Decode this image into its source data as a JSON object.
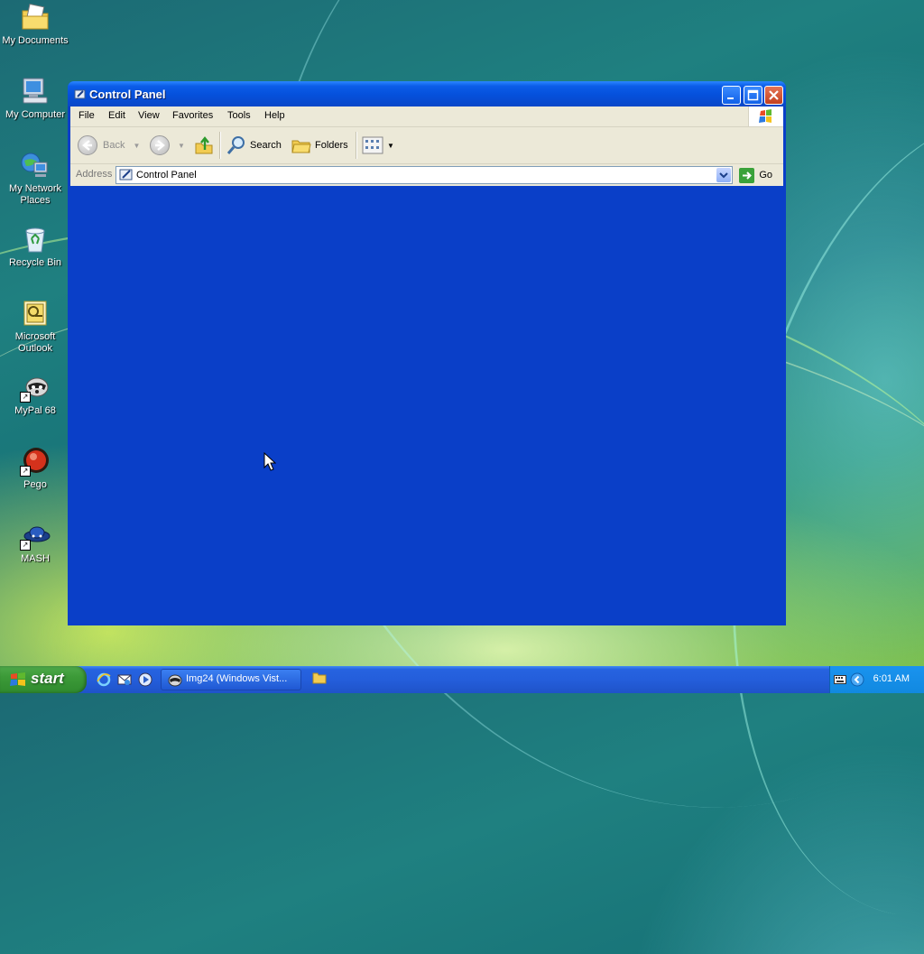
{
  "desktop": {
    "icons": [
      {
        "label": "My Documents",
        "icon": "my-documents-icon"
      },
      {
        "label": "My Computer",
        "icon": "my-computer-icon"
      },
      {
        "label": "My Network Places",
        "icon": "my-network-places-icon"
      },
      {
        "label": "Recycle Bin",
        "icon": "recycle-bin-icon"
      },
      {
        "label": "Microsoft Outlook",
        "icon": "outlook-icon"
      },
      {
        "label": "MyPal 68",
        "icon": "mypal-icon"
      },
      {
        "label": "Pego",
        "icon": "pego-icon"
      },
      {
        "label": "MASH",
        "icon": "mash-icon"
      }
    ]
  },
  "window": {
    "title": "Control Panel",
    "menu": [
      "File",
      "Edit",
      "View",
      "Favorites",
      "Tools",
      "Help"
    ],
    "toolbar": {
      "back_label": "Back",
      "search_label": "Search",
      "folders_label": "Folders"
    },
    "address": {
      "label": "Address",
      "value": "Control Panel",
      "go_label": "Go"
    }
  },
  "taskbar": {
    "start_label": "start",
    "task_label": "Img24 (Windows Vist...",
    "clock": "6:01 AM"
  },
  "colors": {
    "title_blue": "#0550db",
    "chrome": "#ece9d8",
    "start_green": "#3c9a38",
    "taskbar_blue": "#245edb"
  }
}
